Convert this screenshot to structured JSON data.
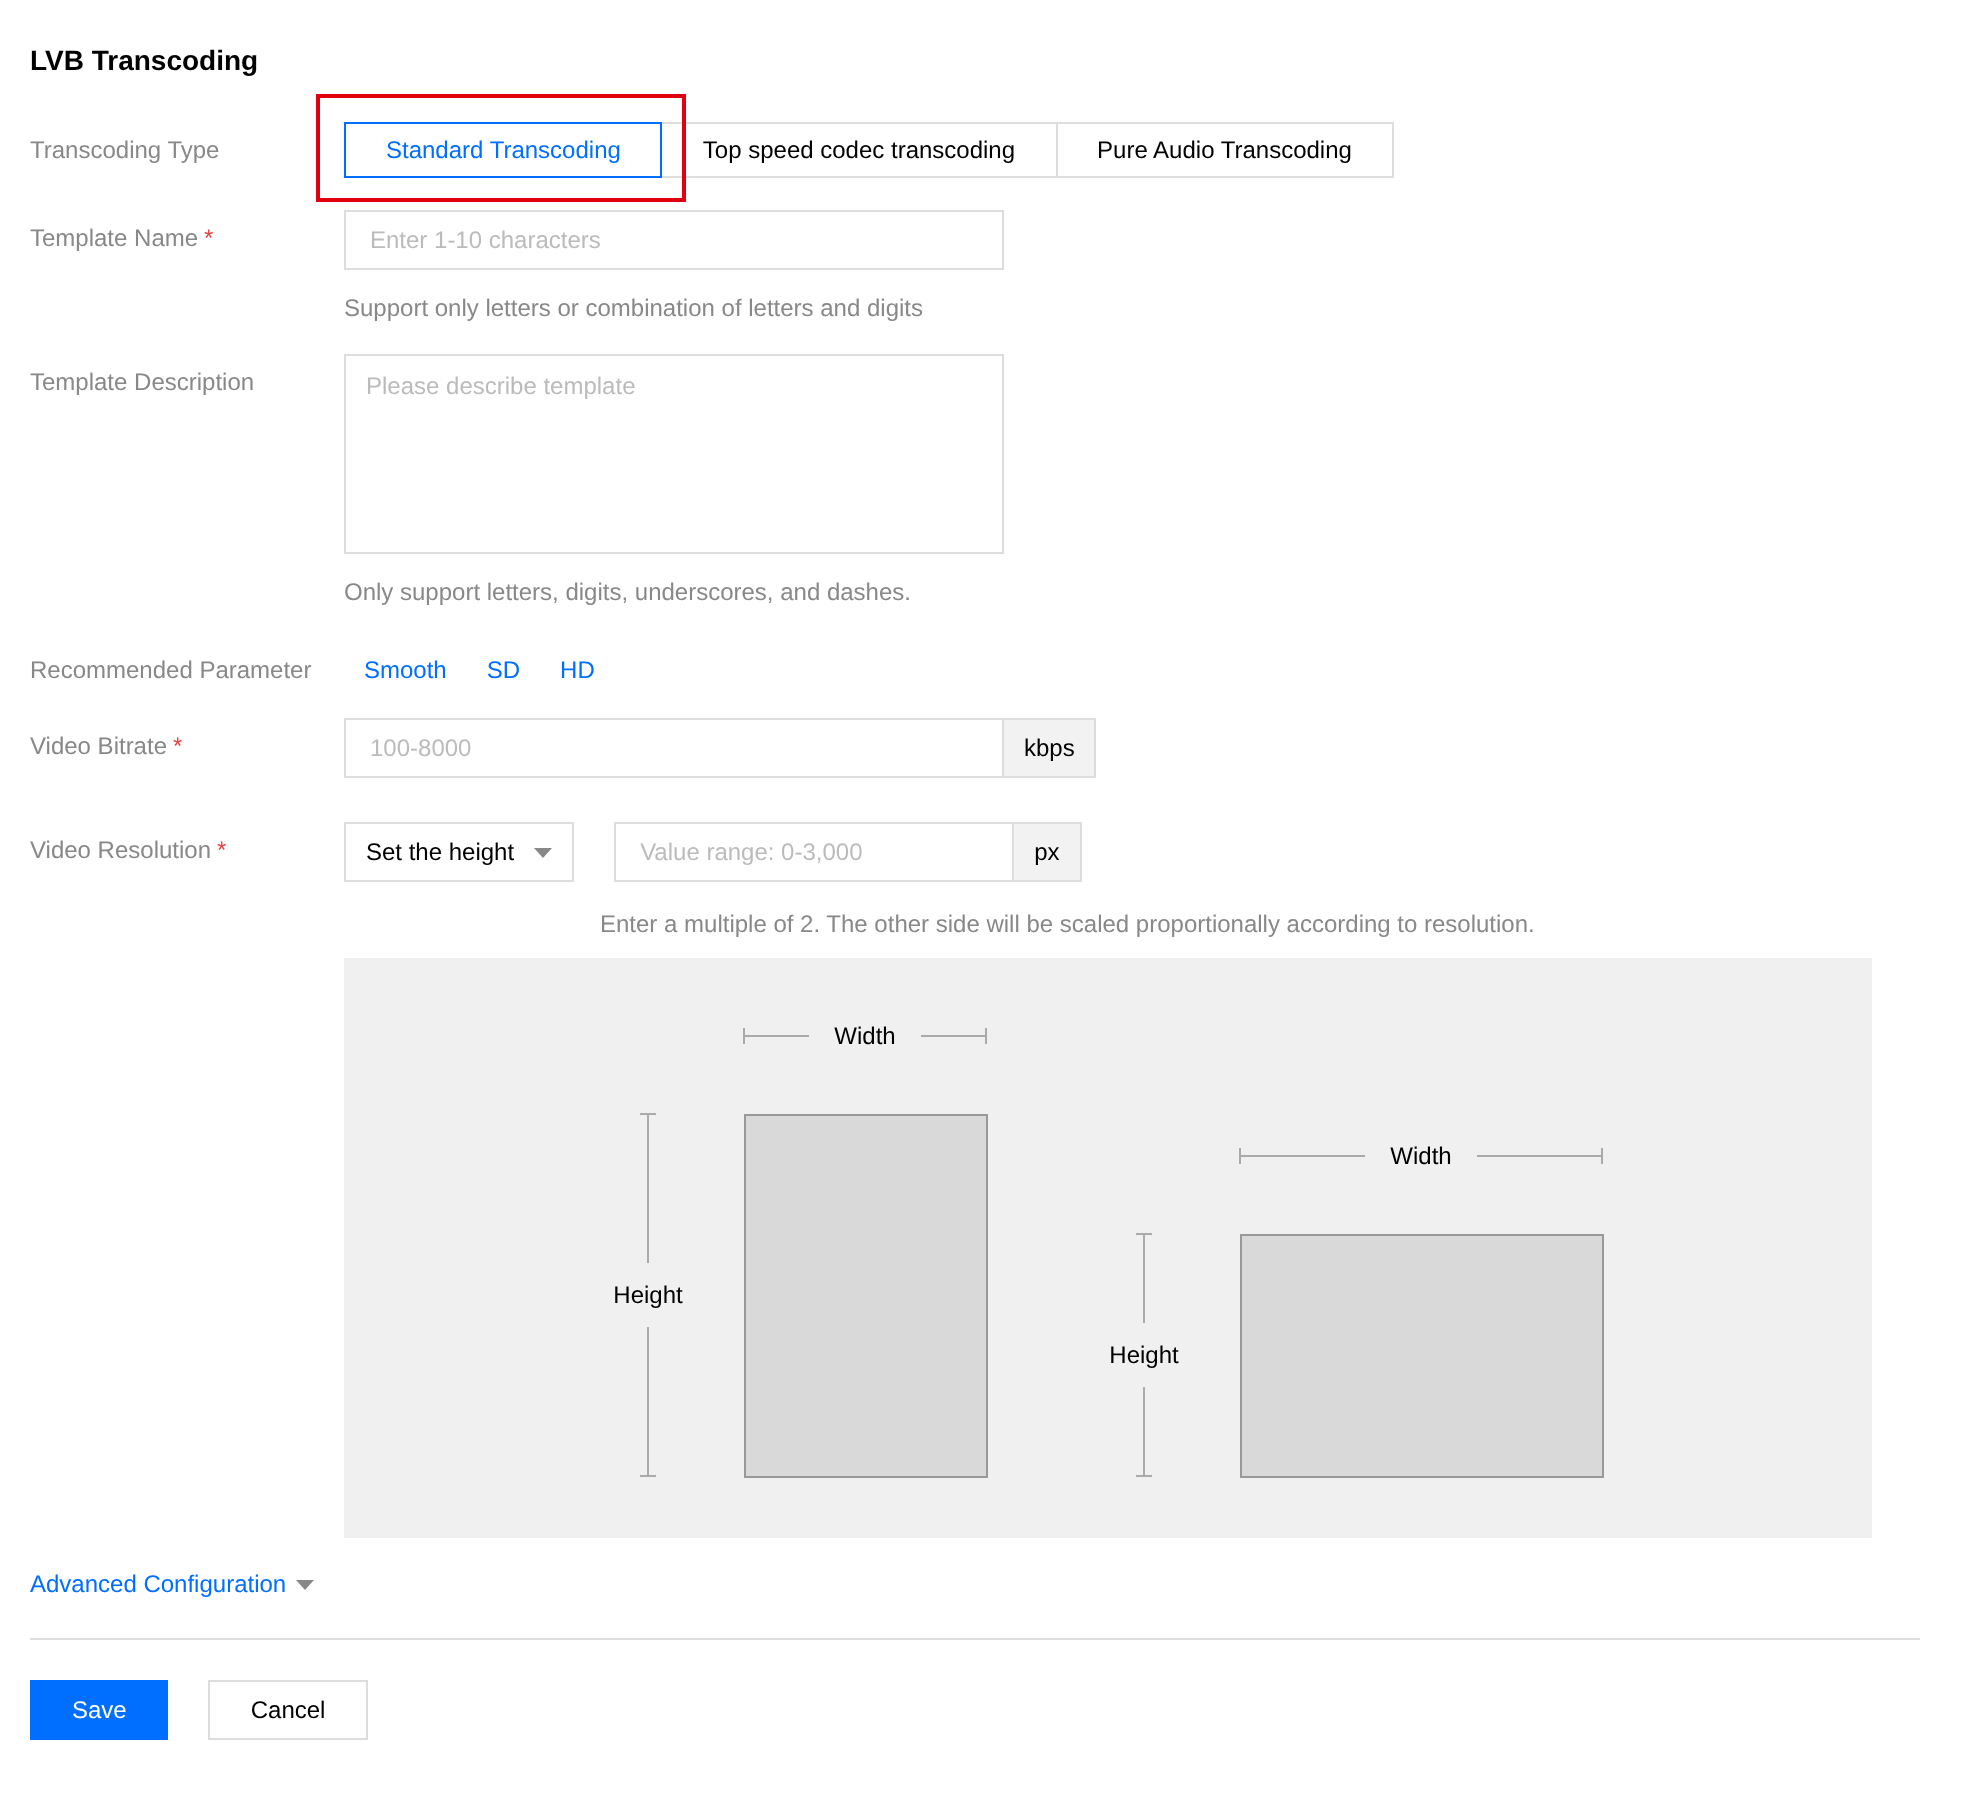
{
  "title": "LVB Transcoding",
  "transcoding_type": {
    "label": "Transcoding Type",
    "tabs": [
      {
        "label": "Standard Transcoding",
        "selected": true,
        "highlighted": true
      },
      {
        "label": "Top speed codec transcoding",
        "selected": false,
        "highlighted": false
      },
      {
        "label": "Pure Audio Transcoding",
        "selected": false,
        "highlighted": false
      }
    ]
  },
  "template_name": {
    "label": "Template Name",
    "required_mark": "*",
    "placeholder": "Enter 1-10 characters",
    "hint": "Support only letters or combination of letters and digits"
  },
  "template_description": {
    "label": "Template Description",
    "placeholder": "Please describe template",
    "hint": "Only support letters, digits, underscores, and dashes."
  },
  "recommended_parameter": {
    "label": "Recommended Parameter",
    "links": [
      "Smooth",
      "SD",
      "HD"
    ]
  },
  "video_bitrate": {
    "label": "Video Bitrate",
    "required_mark": "*",
    "placeholder": "100-8000",
    "unit": "kbps"
  },
  "video_resolution": {
    "label": "Video Resolution",
    "required_mark": "*",
    "select": "Set the height",
    "placeholder": "Value range: 0-3,000",
    "unit": "px",
    "hint": "Enter a multiple of 2. The other side will be scaled proportionally according to resolution."
  },
  "diagram": {
    "portrait": {
      "width_label": "Width",
      "height_label": "Height"
    },
    "landscape": {
      "width_label": "Width",
      "height_label": "Height"
    }
  },
  "advanced_configuration": "Advanced Configuration",
  "buttons": [
    {
      "label": "Save",
      "kind": "primary"
    },
    {
      "label": "Cancel",
      "kind": "default"
    }
  ]
}
